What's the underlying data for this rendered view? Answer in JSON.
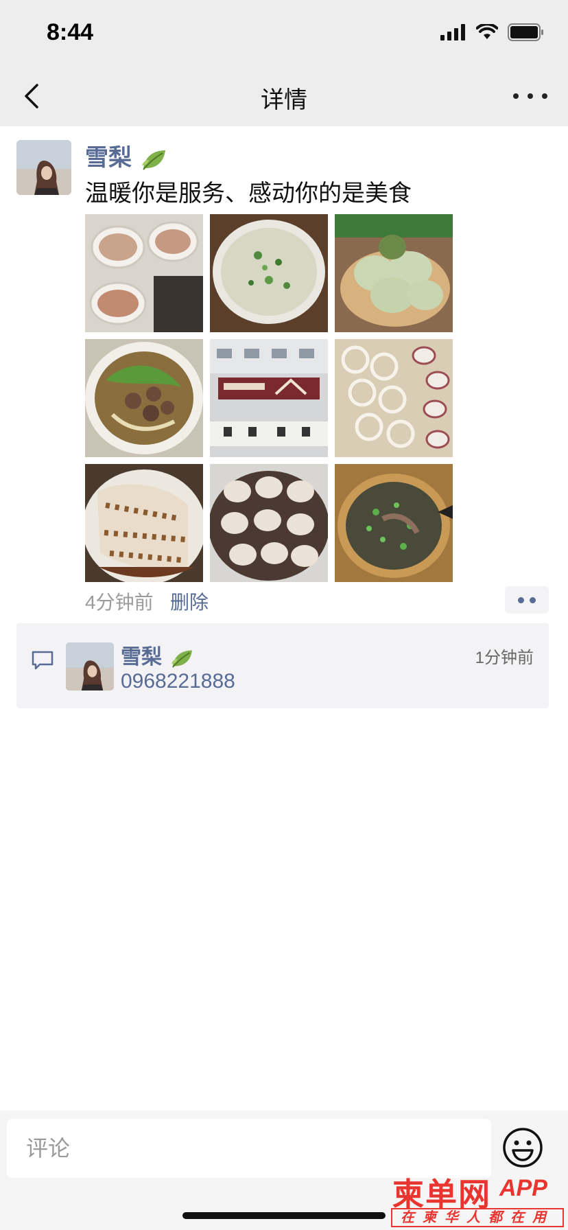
{
  "status_bar": {
    "time": "8:44"
  },
  "header": {
    "title": "详情"
  },
  "post": {
    "author": "雪梨",
    "text": "温暖你是服务、感动你的是美食",
    "photos": [
      "food-photo-cups",
      "food-photo-congee",
      "food-photo-dumplings-steamed",
      "food-photo-beef-noodles",
      "food-photo-restaurant-storefront",
      "food-photo-glasses-and-slices",
      "food-photo-rice-rolls",
      "food-photo-wontons",
      "food-photo-noodle-soup"
    ],
    "time_ago": "4分钟前",
    "delete_label": "删除"
  },
  "comment": {
    "author": "雪梨",
    "text": "0968221888",
    "time_ago": "1分钟前"
  },
  "composer": {
    "placeholder": "评论"
  },
  "watermark": {
    "title": "柬单网",
    "app": "APP",
    "subtitle": "在柬华人都在用"
  },
  "colors": {
    "link_blue": "#576b95",
    "bar_gray": "#ededed",
    "watermark_red": "#e8352f"
  }
}
